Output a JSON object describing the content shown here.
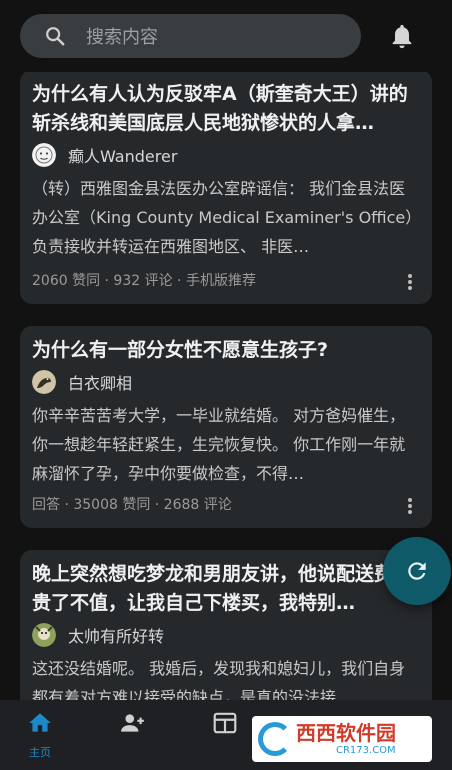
{
  "search": {
    "placeholder": "搜索内容"
  },
  "icons": {
    "search": "search-icon",
    "notification": "bell-icon",
    "refresh": "refresh-icon",
    "home": "home-icon",
    "follow": "add-person-icon",
    "browse": "grid-icon",
    "more": "more-vertical-icon"
  },
  "colors": {
    "background": "#121212",
    "card": "#26292c",
    "accent": "#1e88c8",
    "fab": "#0f5a69"
  },
  "feed": [
    {
      "title": "为什么有人认为反驳牢A（斯奎奇大王）讲的斩杀线和美国底层人民地狱惨状的人拿…",
      "author": "癫人Wanderer",
      "excerpt": "（转）西雅图金县法医办公室辟谣信： 我们金县法医办公室（King County Medical Examiner's Office）负责接收并转运在西雅图地区、 非医…",
      "meta": "2060 赞同 · 932 评论 · 手机版推荐"
    },
    {
      "title": "为什么有一部分女性不愿意生孩子?",
      "author": "白衣卿相",
      "excerpt": "你辛辛苦苦考大学，一毕业就结婚。 对方爸妈催生，你一想趁年轻赶紧生，生完恢复快。 你工作刚一年就麻溜怀了孕，孕中你要做检查，不得…",
      "meta": "回答 · 35008 赞同 · 2688 评论"
    },
    {
      "title": "晚上突然想吃梦龙和男朋友讲，他说配送费太贵了不值，让我自己下楼买，我特别…",
      "author": "太帅有所好转",
      "excerpt": "这还没结婚呢。 我婚后，发现我和媳妇儿，我们自身都有着对方难以接受的缺点，是真的没法接…",
      "meta": ""
    }
  ],
  "nav": {
    "home_label": "主页"
  },
  "watermark": {
    "main": "西西软件园",
    "sub": "CR173.COM"
  }
}
